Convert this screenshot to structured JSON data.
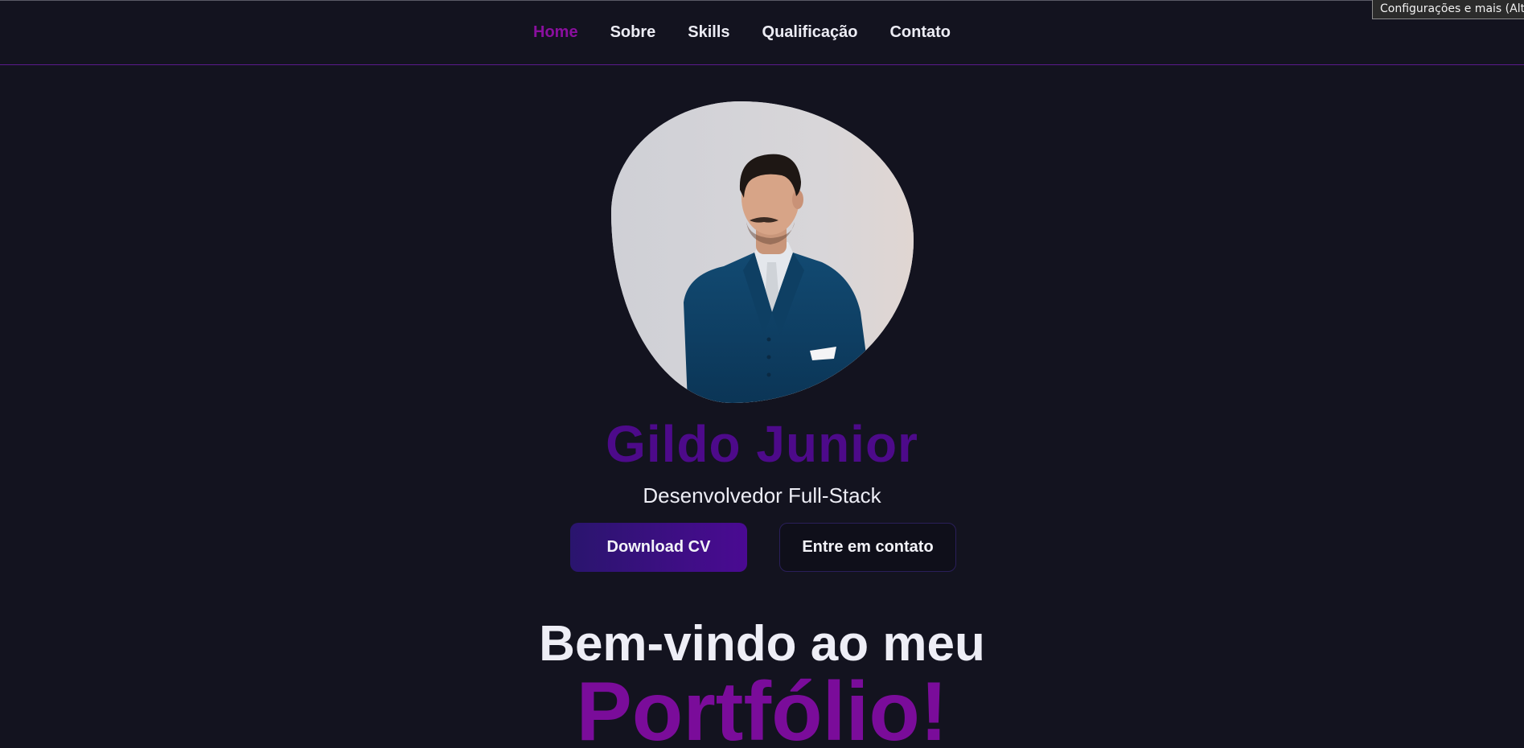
{
  "tooltip": "Configurações e mais (Alt+",
  "nav": {
    "items": [
      {
        "label": "Home",
        "active": true
      },
      {
        "label": "Sobre",
        "active": false
      },
      {
        "label": "Skills",
        "active": false
      },
      {
        "label": "Qualificação",
        "active": false
      },
      {
        "label": "Contato",
        "active": false
      }
    ]
  },
  "hero": {
    "name": "Gildo Junior",
    "role": "Desenvolvedor Full-Stack",
    "download_button": "Download CV",
    "contact_button": "Entre em contato",
    "welcome": "Bem-vindo ao meu",
    "highlight": "Portfólio!"
  },
  "colors": {
    "background": "#13131f",
    "accent": "#8a0f9e",
    "name": "#4d0a8a"
  }
}
